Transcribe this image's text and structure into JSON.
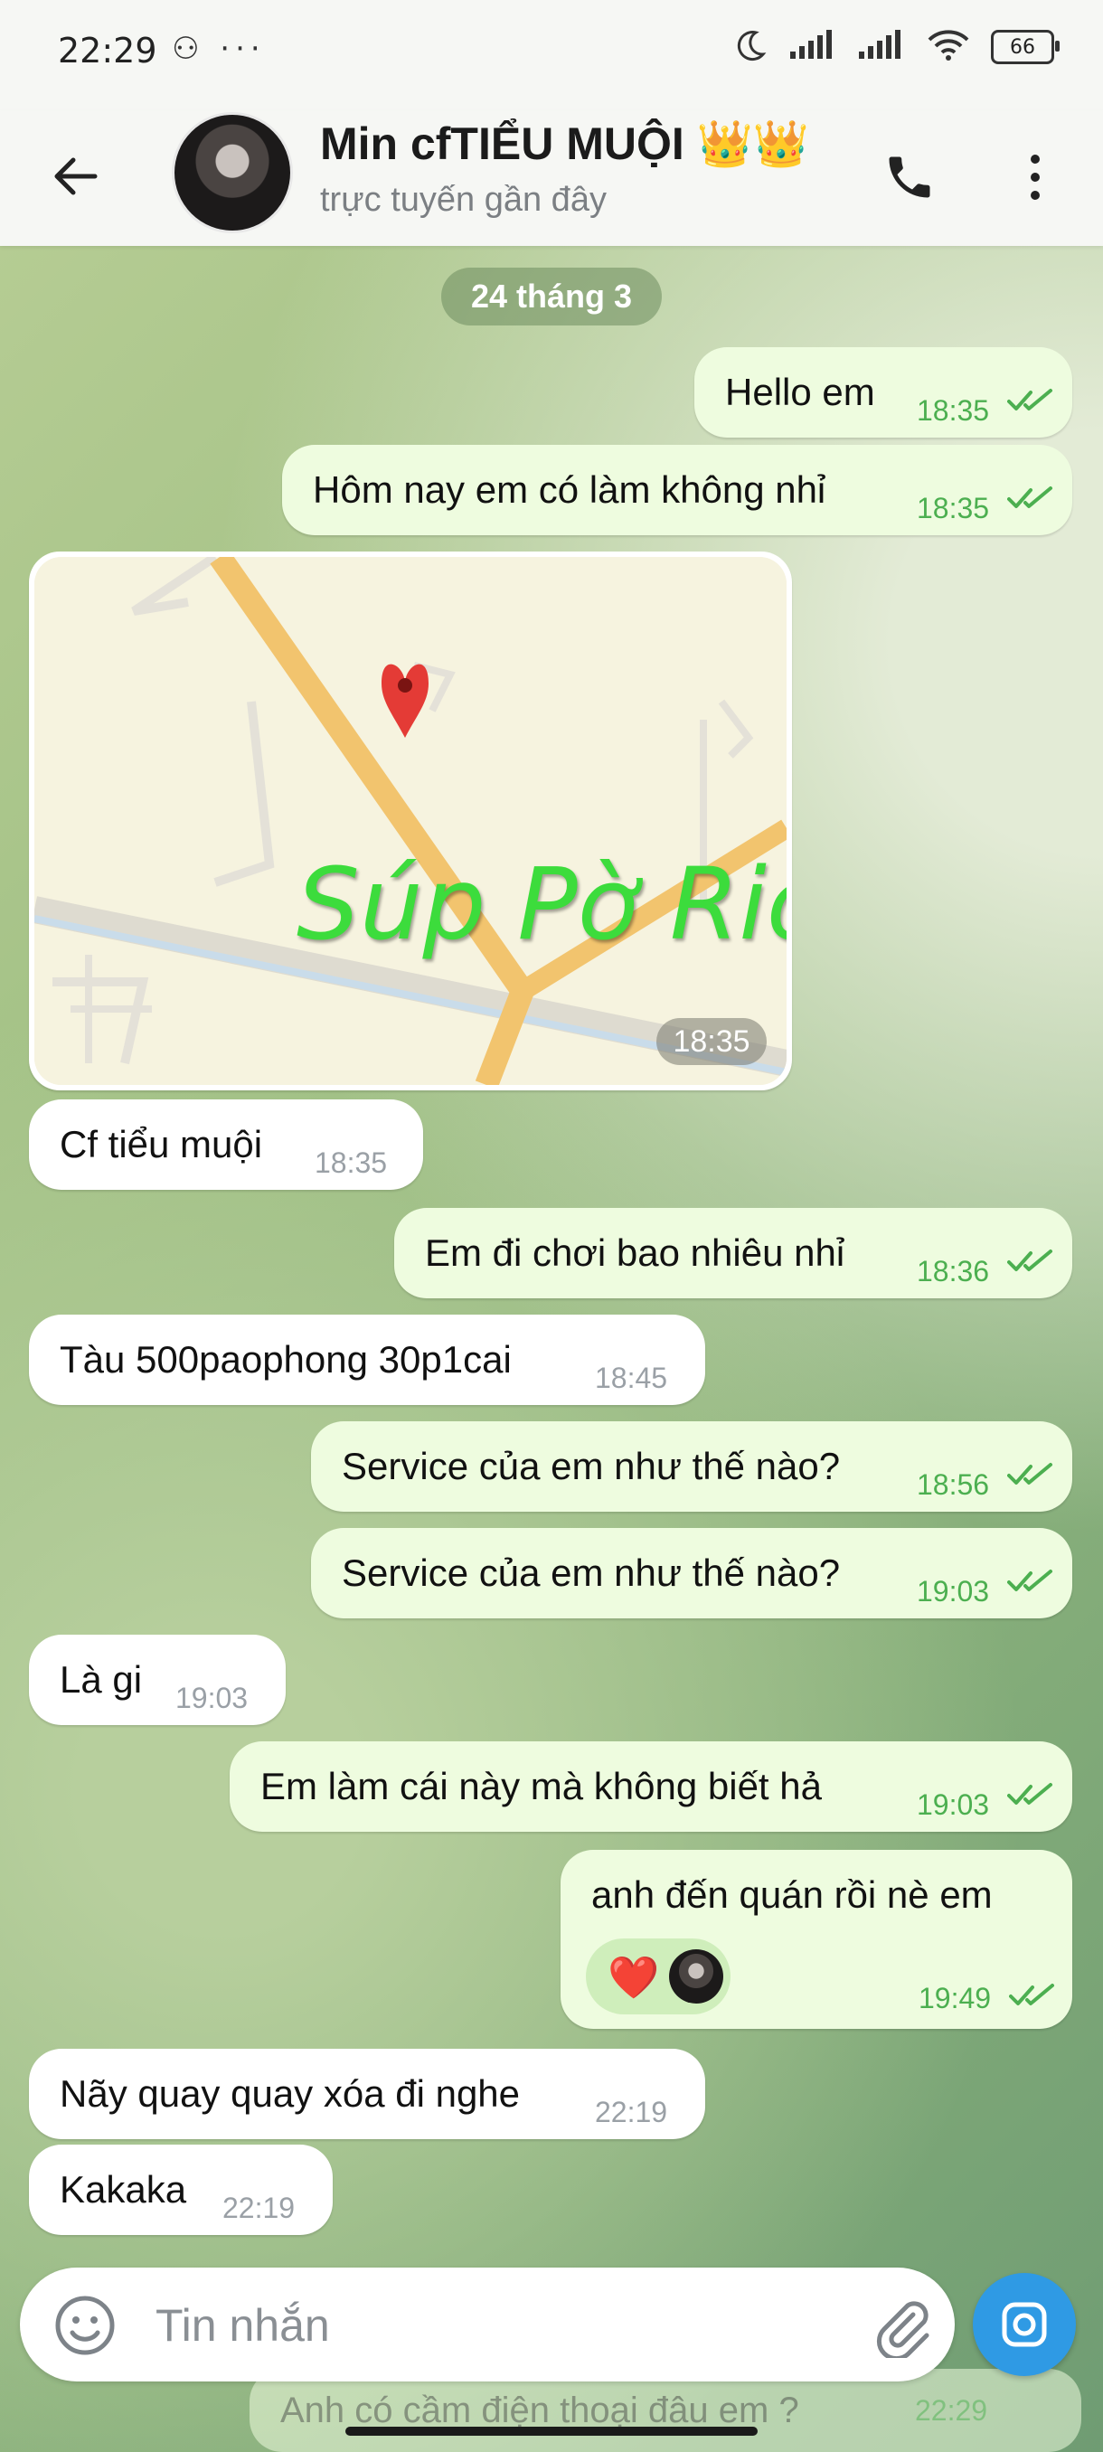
{
  "status_bar": {
    "time": "22:29",
    "left_icons": "⚇ ···",
    "battery": "66"
  },
  "header": {
    "name": "Min cfTIỂU MUỘI 👑👑",
    "status": "trực tuyến gần đây"
  },
  "chat": {
    "date_separator": "24 tháng 3",
    "messages": [
      {
        "text": "Hello em",
        "time": "18:35",
        "direction": "out",
        "read": true
      },
      {
        "text": "Hôm nay em có làm không nhỉ",
        "time": "18:35",
        "direction": "out",
        "read": true
      },
      {
        "text": "Cf tiểu muội",
        "time": "18:35",
        "direction": "in"
      },
      {
        "text": "Em đi chơi bao nhiêu nhỉ",
        "time": "18:36",
        "direction": "out",
        "read": true
      },
      {
        "text": "Tàu 500paophong 30p1cai",
        "time": "18:45",
        "direction": "in"
      },
      {
        "text": "Service của em như thế nào?",
        "time": "18:56",
        "direction": "out",
        "read": true
      },
      {
        "text": "Service của em như thế nào?",
        "time": "19:03",
        "direction": "out",
        "read": true
      },
      {
        "text": "Là gi",
        "time": "19:03",
        "direction": "in"
      },
      {
        "text": "Em làm cái này mà không biết hả",
        "time": "19:03",
        "direction": "out",
        "read": true
      },
      {
        "text": "anh đến quán rồi nè em",
        "time": "19:49",
        "direction": "out",
        "read": true,
        "reaction": "❤️"
      },
      {
        "text": "Nãy quay quay xóa đi nghe",
        "time": "22:19",
        "direction": "in"
      },
      {
        "text": "Kakaka",
        "time": "22:19",
        "direction": "in"
      }
    ],
    "location": {
      "overlay_text": "Súp Pờ Rio",
      "time": "18:35"
    },
    "partial_message": {
      "text": "Anh có cầm điện thoại đâu em ?",
      "time": "22:29"
    }
  },
  "composer": {
    "placeholder": "Tin nhắn"
  },
  "colors": {
    "outgoing_bubble": "#eefcdf",
    "incoming_bubble": "#ffffff",
    "read_check": "#4caf50",
    "camera_button": "#2f9ae4"
  }
}
